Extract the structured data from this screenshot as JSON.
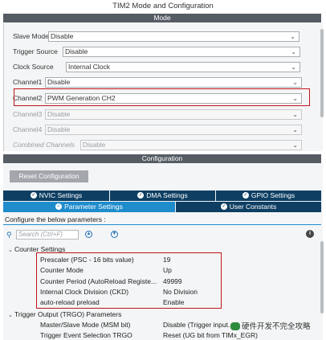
{
  "window": {
    "title": "TIM2 Mode and Configuration"
  },
  "mode_section": {
    "header": "Mode",
    "rows": [
      {
        "label": "Slave Mode",
        "value": "Disable"
      },
      {
        "label": "Trigger Source",
        "value": "Disable"
      },
      {
        "label": "Clock Source",
        "value": "Internal Clock"
      },
      {
        "label": "Channel1",
        "value": "Disable"
      },
      {
        "label": "Channel2",
        "value": "PWM Generation CH2"
      },
      {
        "label": "Channel3",
        "value": "Disable"
      },
      {
        "label": "Channel4",
        "value": "Disable"
      },
      {
        "label": "Combined Channels",
        "value": "Disable"
      }
    ]
  },
  "config_section": {
    "header": "Configuration",
    "reset_button": "Reset Configuration",
    "tabs_row1": [
      "NVIC Settings",
      "DMA Settings",
      "GPIO Settings"
    ],
    "tabs_row2": [
      "Parameter Settings",
      "User Constants"
    ],
    "hint": "Configure the below parameters :",
    "search_placeholder": "Search (Ctrl+F)"
  },
  "parameters": {
    "group1": "Counter Settings",
    "items": [
      {
        "name": "Prescaler (PSC - 16 bits value)",
        "value": "19"
      },
      {
        "name": "Counter Mode",
        "value": "Up"
      },
      {
        "name": "Counter Period (AutoReload Registe...",
        "value": "49999"
      },
      {
        "name": "Internal Clock Division (CKD)",
        "value": "No Division"
      },
      {
        "name": "auto-reload preload",
        "value": "Enable"
      }
    ],
    "group2": "Trigger Output (TRGO) Parameters",
    "trgo_items": [
      {
        "name": "Master/Slave Mode (MSM bit)",
        "value": "Disable (Trigger input..."
      },
      {
        "name": "Trigger Event Selection TRGO",
        "value": "Reset (UG bit from TIMx_EGR)"
      }
    ]
  },
  "watermark": "硬件开发不完全攻略",
  "colors": {
    "highlight": "#c0151c",
    "tab_dark": "#0e3f63",
    "tab_active": "#1f8ccc",
    "section_bar": "#565c64"
  }
}
